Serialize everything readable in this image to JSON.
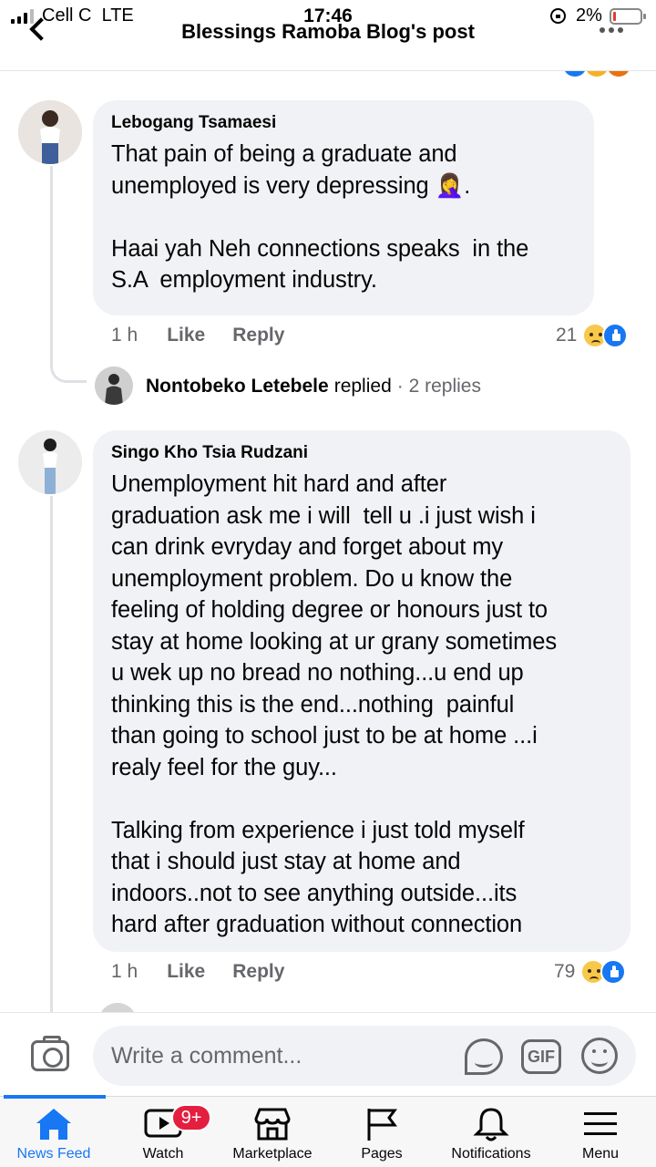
{
  "status_bar": {
    "carrier": "Cell C",
    "network": "LTE",
    "time": "17:46",
    "battery": "2%"
  },
  "header": {
    "title": "Blessings Ramoba Blog's post"
  },
  "comments": [
    {
      "author": "Lebogang Tsamaesi",
      "text": "That pain of being a graduate and\nunemployed is very depressing 🤦‍♀️.\n\nHaai yah Neh connections speaks  in the\nS.A  employment industry.",
      "time": "1 h",
      "like_label": "Like",
      "reply_label": "Reply",
      "reaction_count": "21",
      "reactions": [
        "sad-icon",
        "like-icon"
      ],
      "replies": {
        "name": "Nontobeko Letebele",
        "verb": "replied",
        "count": "· 2 replies"
      }
    },
    {
      "author": "Singo Kho Tsia Rudzani",
      "text": "Unemployment hit hard and after\ngraduation ask me i will  tell u .i just wish i\ncan drink evryday and forget about my\nunemployment problem. Do u know the\nfeeling of holding degree or honours just to\nstay at home looking at ur grany sometimes\nu wek up no bread no nothing...u end up\nthinking this is the end...nothing  painful\nthan going to school just to be at home ...i\nrealy feel for the guy...\n\nTalking from experience i just told myself\nthat i should just stay at home and\nindoors..not to see anything outside...its\nhard after graduation without connection",
      "time": "1 h",
      "like_label": "Like",
      "reply_label": "Reply",
      "reaction_count": "79",
      "reactions": [
        "sad-icon",
        "like-icon"
      ]
    }
  ],
  "composer": {
    "placeholder": "Write a comment...",
    "gif_label": "GIF"
  },
  "tabs": [
    {
      "label": "News Feed",
      "icon": "home-icon",
      "active": true
    },
    {
      "label": "Watch",
      "icon": "watch-icon",
      "badge": "9+"
    },
    {
      "label": "Marketplace",
      "icon": "marketplace-icon"
    },
    {
      "label": "Pages",
      "icon": "flag-icon"
    },
    {
      "label": "Notifications",
      "icon": "bell-icon"
    },
    {
      "label": "Menu",
      "icon": "menu-icon"
    }
  ],
  "colors": {
    "accent": "#1877f2",
    "bubble": "#f0f2f5",
    "secondary_text": "#65676b",
    "badge": "#e41e3f"
  }
}
